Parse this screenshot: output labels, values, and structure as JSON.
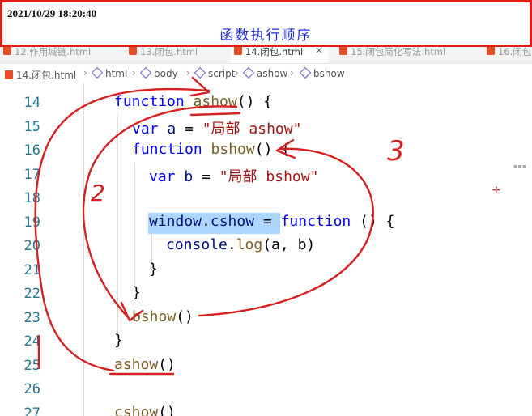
{
  "banner": {
    "timestamp": "2021/10/29 18:20:40",
    "title": "函数执行顺序"
  },
  "tabs": [
    {
      "label": "12.作用域链.html",
      "active": false
    },
    {
      "label": "13.闭包.html",
      "active": false
    },
    {
      "label": "14.闭包.html",
      "active": true
    },
    {
      "label": "15.闭包简化写法.html",
      "active": false
    },
    {
      "label": "16.闭包",
      "active": false
    }
  ],
  "breadcrumb": {
    "file": "14.闭包.html",
    "items": [
      "html",
      "body",
      "script",
      "ashow",
      "bshow"
    ]
  },
  "editor": {
    "line_numbers": [
      "14",
      "15",
      "16",
      "17",
      "18",
      "19",
      "20",
      "21",
      "22",
      "23",
      "24",
      "25",
      "26",
      "27"
    ],
    "lines": {
      "l14": {
        "kw": "function",
        "name": "ashow",
        "rest": "() {"
      },
      "l15": {
        "kw": "var",
        "name": "a",
        "op": " = ",
        "str": "\"局部 ashow\""
      },
      "l16": {
        "kw": "function",
        "name": "bshow",
        "rest": "() {"
      },
      "l17": {
        "kw": "var",
        "name": "b",
        "op": " = ",
        "str": "\"局部 bshow\""
      },
      "l19": {
        "obj": "window",
        "dot": ".",
        "prop": "cshow",
        "op": " = ",
        "kw": "function",
        "rest": " () {"
      },
      "l20": {
        "obj": "console",
        "dot": ".",
        "method": "log",
        "rest": "(a, b)"
      },
      "l21": "}",
      "l22": "}",
      "l23": {
        "name": "bshow",
        "rest": "()"
      },
      "l24": "}",
      "l25": {
        "name": "ashow",
        "rest": "()"
      },
      "l27": {
        "name": "cshow",
        "rest": "()"
      }
    }
  },
  "annotations": {
    "step_2": "2",
    "step_3": "3"
  },
  "colors": {
    "annotation_red": "#d6201f",
    "banner_title_blue": "#1b2bd8",
    "keyword_blue": "#0000ff",
    "function_brown": "#795e26",
    "string_red": "#a31515",
    "line_number": "#237893",
    "selection": "#add6ff"
  }
}
